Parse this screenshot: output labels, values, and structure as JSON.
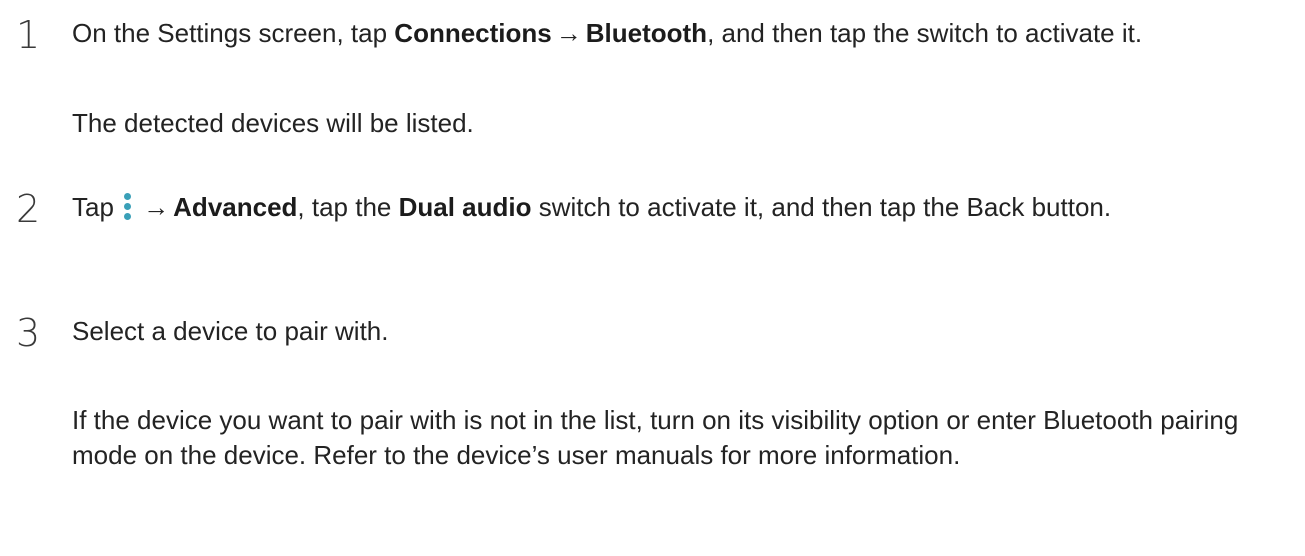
{
  "steps": [
    {
      "number": "1",
      "text_1": "On the Settings screen, tap ",
      "bold_1": "Connections",
      "arrow": "→",
      "bold_2": "Bluetooth",
      "text_2": ", and then tap the switch to activate it.",
      "note": "The detected devices will be listed."
    },
    {
      "number": "2",
      "text_1": "Tap ",
      "icon": "more-options-icon",
      "arrow": "→",
      "bold_1": "Advanced",
      "text_2": ", tap the ",
      "bold_2": "Dual audio",
      "text_3": " switch to activate it, and then tap the Back button."
    },
    {
      "number": "3",
      "text_1": "Select a device to pair with.",
      "note": "If the device you want to pair with is not in the list, turn on its visibility option or enter Bluetooth pairing mode on the device. Refer to the device’s user manuals for more information."
    }
  ],
  "colors": {
    "text": "#232323",
    "icon_accent": "#3aa0b8"
  }
}
